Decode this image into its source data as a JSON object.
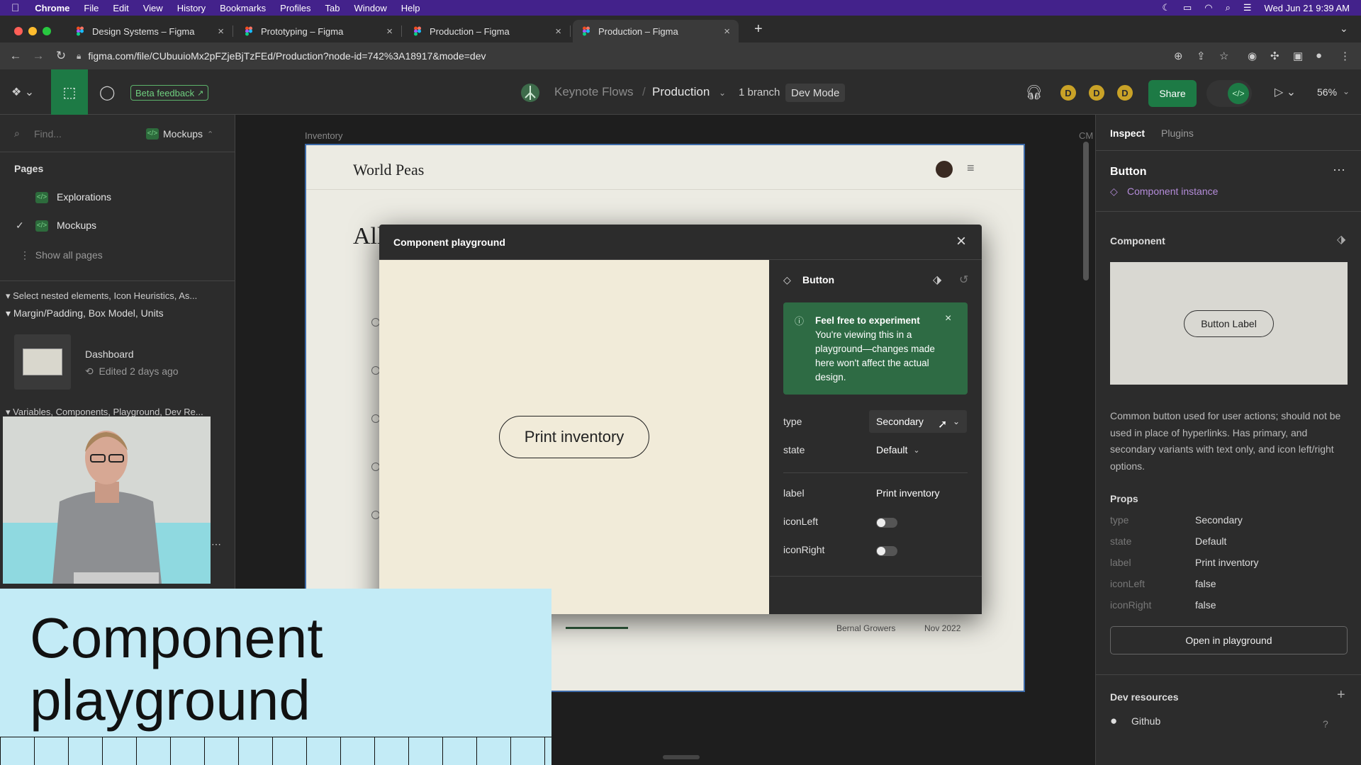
{
  "menubar": {
    "app": "Chrome",
    "items": [
      "File",
      "Edit",
      "View",
      "History",
      "Bookmarks",
      "Profiles",
      "Tab",
      "Window",
      "Help"
    ],
    "clock": "Wed Jun 21  9:39 AM"
  },
  "tabs": [
    {
      "title": "Design Systems – Figma"
    },
    {
      "title": "Prototyping – Figma"
    },
    {
      "title": "Production – Figma"
    },
    {
      "title": "Production – Figma"
    }
  ],
  "address": {
    "url": "figma.com/file/CUbuuioMx2pFZjeBjTzFEd/Production?node-id=742%3A18917&mode=dev"
  },
  "toolbar": {
    "beta_feedback": "Beta feedback",
    "project": "Keynote Flows",
    "file": "Production",
    "branch": "1 branch",
    "mode": "Dev Mode",
    "avatars": [
      "D",
      "D",
      "D"
    ],
    "share": "Share",
    "zoom": "56%"
  },
  "left": {
    "find_placeholder": "Find...",
    "page_selector": "Mockups",
    "pages_title": "Pages",
    "pages": [
      "Explorations",
      "Mockups"
    ],
    "show_all": "Show all pages",
    "section1": "Select nested elements, Icon Heuristics, As...",
    "section1b": "Margin/Padding, Box Model, Units",
    "frame_name": "Dashboard",
    "frame_meta": "Edited 2 days ago",
    "section2": "Variables, Components, Playground, Dev Re..."
  },
  "canvas": {
    "frame_label": "Inventory",
    "side_label": "CM",
    "brand": "World Peas",
    "heading_partial": "All",
    "grower": "Bernal Growers",
    "date": "Nov 2022"
  },
  "playground": {
    "title": "Component playground",
    "component": "Button",
    "preview_label": "Print inventory",
    "notice_title": "Feel free to experiment",
    "notice_body": "You're viewing this in a playground—changes made here won't affect the actual design.",
    "props": {
      "type_label": "type",
      "type_value": "Secondary",
      "state_label": "state",
      "state_value": "Default",
      "label_label": "label",
      "label_value": "Print inventory",
      "iconleft_label": "iconLeft",
      "iconright_label": "iconRight"
    }
  },
  "right": {
    "tab_inspect": "Inspect",
    "tab_plugins": "Plugins",
    "name": "Button",
    "kind": "Component instance",
    "component_title": "Component",
    "preview_button": "Button Label",
    "description": "Common button used for user actions; should not be used in place of hyperlinks. Has primary, and secondary variants with text only, and icon left/right options.",
    "props_title": "Props",
    "props": [
      {
        "k": "type",
        "v": "Secondary"
      },
      {
        "k": "state",
        "v": "Default"
      },
      {
        "k": "label",
        "v": "Print inventory"
      },
      {
        "k": "iconLeft",
        "v": "false"
      },
      {
        "k": "iconRight",
        "v": "false"
      }
    ],
    "open_playground": "Open in playground",
    "dev_resources": "Dev resources",
    "github": "Github"
  },
  "overlay": {
    "line1": "Component",
    "line2": "playground"
  },
  "colors": {
    "accent_green": "#1d7a45",
    "notice_green": "#2e6b44",
    "avatar_gold": "#c9a227",
    "frame_border": "#3c6aa8",
    "overlay_blue": "#c3ebf6"
  }
}
